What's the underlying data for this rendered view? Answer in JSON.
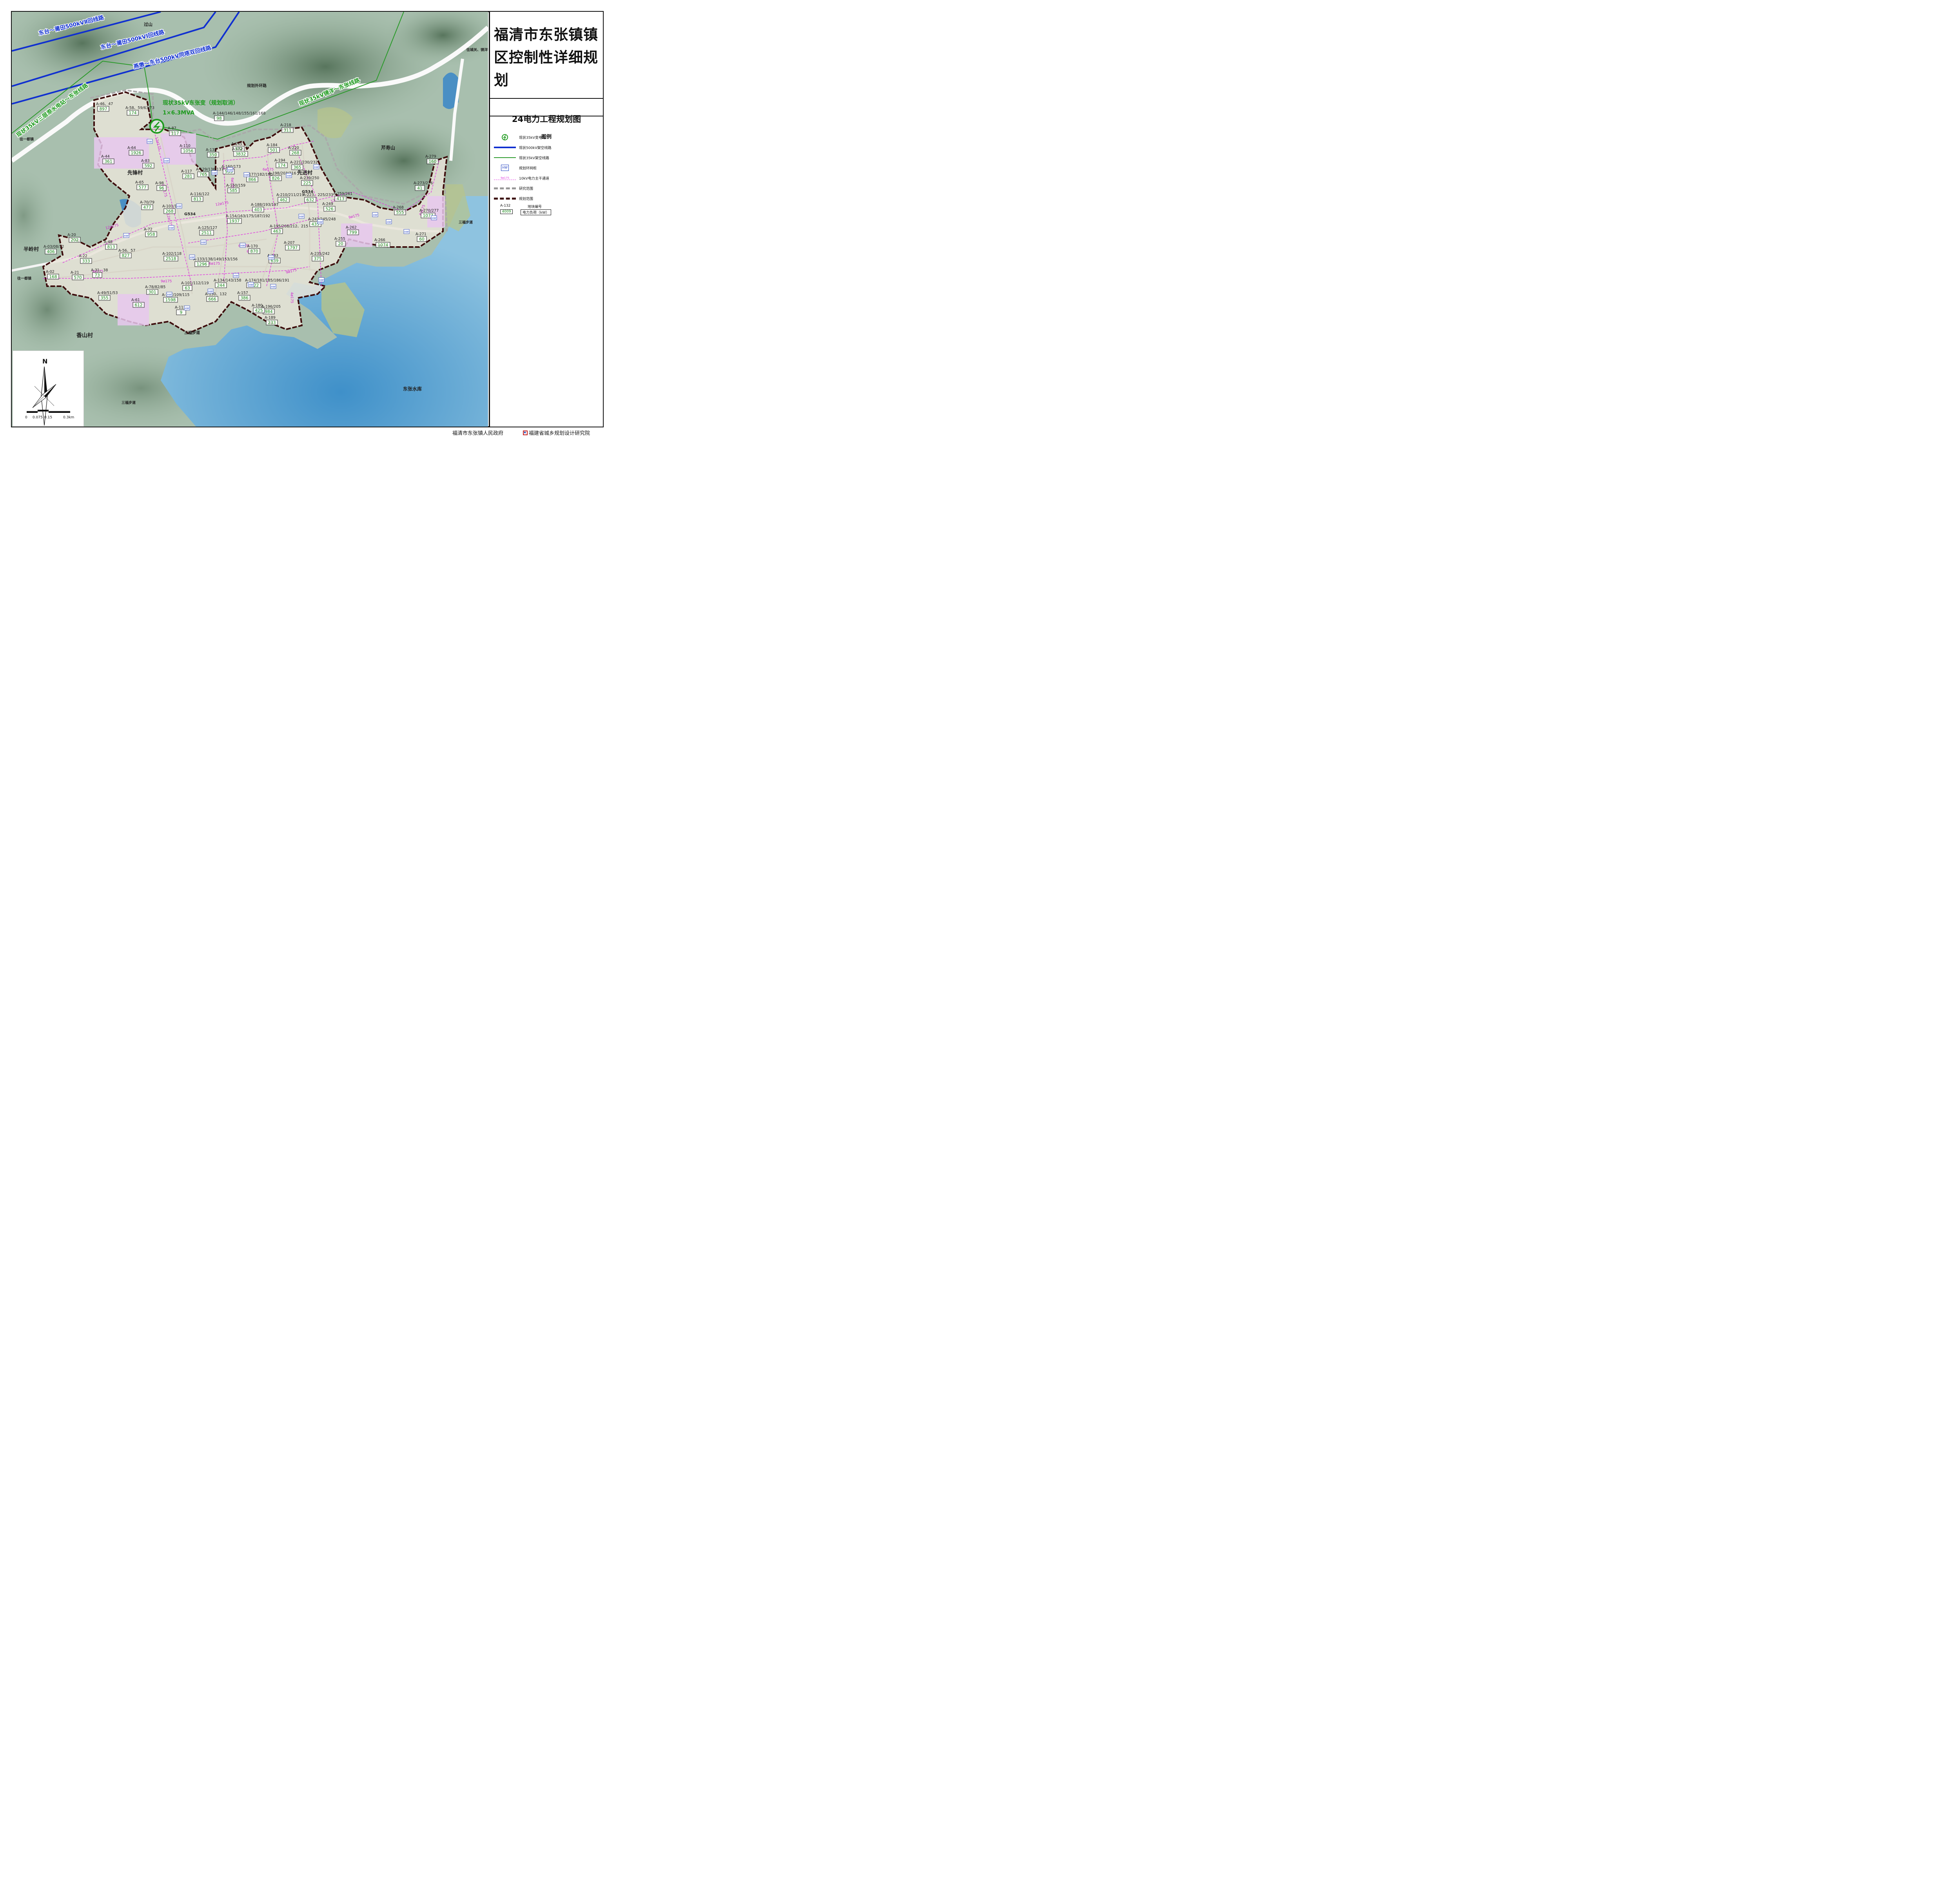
{
  "title": "福清市东张镇镇区控制性详细规划",
  "subtitle": "24电力工程规划图",
  "legend": {
    "heading": "图例",
    "items": [
      {
        "label": "现状35kV变电站",
        "icon": "substation-icon"
      },
      {
        "label": "现状500kV架空线路",
        "color": "#1030d0"
      },
      {
        "label": "现状35kV架空线路",
        "color": "#2a9a2a"
      },
      {
        "label": "规划环网柜",
        "icon": "ring-main-unit-icon",
        "symbol": "HW"
      },
      {
        "label": "10kV电力主干通道",
        "symbol": "9ø175",
        "color": "#e040e0"
      },
      {
        "label": "研究范围"
      },
      {
        "label": "规划范围"
      }
    ],
    "sample": {
      "code": "A-132",
      "load": "4009",
      "code_label": "地块编号",
      "load_label": "电力负荷（kW）"
    }
  },
  "footer": {
    "left": "福清市东张镇人民政府",
    "right": "福建省城乡规划设计研究院"
  },
  "scale_bar": {
    "north": "N",
    "ticks": [
      "0",
      "0.075",
      "0.15",
      "0.3km"
    ]
  },
  "power_lines": [
    {
      "label": "东台～莆田500kVⅡ回线路",
      "kind": "500kV"
    },
    {
      "label": "东台～莆田500kVⅠ回线路",
      "kind": "500kV"
    },
    {
      "label": "燕墩～东台500kV同塔双回线路",
      "kind": "500kV"
    },
    {
      "label": "现状35kV三层漈水电站～东张线路",
      "kind": "35kV"
    },
    {
      "label": "现状35kV镜洋～东张线路",
      "kind": "35kV"
    }
  ],
  "substation": {
    "line1": "现状35kV东张变（规划取消）",
    "line2": "1×6.3MVA"
  },
  "place_names": [
    "过山",
    "芹寿山",
    "先锋村",
    "先进村",
    "半岭村",
    "香山村",
    "东张水库",
    "规划外环路",
    "G534",
    "G534",
    "往一都镇",
    "往一都镇",
    "往城关、镜洋镇",
    "三福步道",
    "三福步道",
    "三福步道"
  ],
  "conduits": [
    "12ø175",
    "12ø175",
    "12ø175",
    "12ø175",
    "12ø175",
    "12ø175",
    "9ø175",
    "9ø175",
    "9ø175",
    "9ø175",
    "6ø175",
    "6ø175",
    "6ø175",
    "6ø175",
    "4ø175",
    "6ø175",
    "9ø175",
    "6ø175"
  ],
  "parcels": [
    {
      "code": "A-46、47",
      "load": "897"
    },
    {
      "code": "A-58、59/63/73",
      "load": "174"
    },
    {
      "code": "A-64",
      "load": "1926"
    },
    {
      "code": "A-44",
      "load": "361"
    },
    {
      "code": "A-83",
      "load": "592"
    },
    {
      "code": "A-87",
      "load": "117"
    },
    {
      "code": "A-110",
      "load": "1056"
    },
    {
      "code": "A-144/146/148/155/161/168",
      "load": "98"
    },
    {
      "code": "A-145",
      "load": "372"
    },
    {
      "code": "A-152",
      "load": "3832"
    },
    {
      "code": "A-135",
      "load": "350"
    },
    {
      "code": "A-184",
      "load": "501"
    },
    {
      "code": "A-218",
      "load": "311"
    },
    {
      "code": "A-220",
      "load": "268"
    },
    {
      "code": "A-194",
      "load": "174"
    },
    {
      "code": "A-221/230/232",
      "load": "365"
    },
    {
      "code": "A-279",
      "load": "160"
    },
    {
      "code": "A-65",
      "load": "577"
    },
    {
      "code": "A-98",
      "load": "96"
    },
    {
      "code": "A-117",
      "load": "281"
    },
    {
      "code": "A-129/136/137",
      "load": "765"
    },
    {
      "code": "A-160/173",
      "load": "535"
    },
    {
      "code": "A-177/182/190",
      "load": "866"
    },
    {
      "code": "A-198/203/216",
      "load": "826"
    },
    {
      "code": "A-239/250",
      "load": "225"
    },
    {
      "code": "A-273/276",
      "load": "41"
    },
    {
      "code": "A-116/122",
      "load": "813"
    },
    {
      "code": "A-150/159",
      "load": "585"
    },
    {
      "code": "A-210/211/219",
      "load": "462"
    },
    {
      "code": "A-223、225/233",
      "load": "632"
    },
    {
      "code": "A-259/261",
      "load": "413"
    },
    {
      "code": "A-70/79",
      "load": "477"
    },
    {
      "code": "A-101/106",
      "load": "268"
    },
    {
      "code": "A-188/193/197",
      "load": "403"
    },
    {
      "code": "A-249",
      "load": "526"
    },
    {
      "code": "A-268",
      "load": "555"
    },
    {
      "code": "A-270/277",
      "load": "1077"
    },
    {
      "code": "A-154/163/175/187/192",
      "load": "1937"
    },
    {
      "code": "A-125/127",
      "load": "2511"
    },
    {
      "code": "A-72",
      "load": "958"
    },
    {
      "code": "A-195/208/212、215",
      "load": "463"
    },
    {
      "code": "A-243/245/248",
      "load": "435"
    },
    {
      "code": "A-262",
      "load": "799"
    },
    {
      "code": "A-266",
      "load": "1074"
    },
    {
      "code": "A-271",
      "load": "60"
    },
    {
      "code": "A-20",
      "load": "202"
    },
    {
      "code": "A-48",
      "load": "813"
    },
    {
      "code": "A-03/08/12",
      "load": "406"
    },
    {
      "code": "A-56、57",
      "load": "827"
    },
    {
      "code": "A-102/118",
      "load": "2518"
    },
    {
      "code": "A-170",
      "load": "870"
    },
    {
      "code": "A-207",
      "load": "1797"
    },
    {
      "code": "A-255",
      "load": "20"
    },
    {
      "code": "A-22",
      "load": "333"
    },
    {
      "code": "A-183",
      "load": "639"
    },
    {
      "code": "A-235/242",
      "load": "375"
    },
    {
      "code": "A-133/138/149/153/156",
      "load": "1296"
    },
    {
      "code": "A-02",
      "load": "168"
    },
    {
      "code": "A-21",
      "load": "570"
    },
    {
      "code": "A-31、38",
      "load": "73"
    },
    {
      "code": "A-101/112/119",
      "load": "63"
    },
    {
      "code": "A-134/143/158",
      "load": "244"
    },
    {
      "code": "A-174/181/185/186/191",
      "load": "1022"
    },
    {
      "code": "A-78/82/85",
      "load": "301"
    },
    {
      "code": "A-49/51/53",
      "load": "355"
    },
    {
      "code": "A-107/109/115",
      "load": "1598"
    },
    {
      "code": "A-130、132",
      "load": "666"
    },
    {
      "code": "A-157",
      "load": "386"
    },
    {
      "code": "A-61",
      "load": "612"
    },
    {
      "code": "A-113",
      "load": "9"
    },
    {
      "code": "A-196/205",
      "load": "984"
    },
    {
      "code": "A-180",
      "load": "425"
    },
    {
      "code": "A-189",
      "load": "233"
    }
  ]
}
